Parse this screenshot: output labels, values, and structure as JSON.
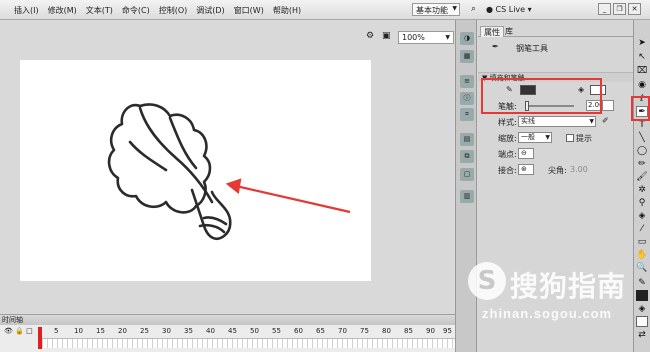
{
  "menubar": {
    "items": [
      "插入(I)",
      "修改(M)",
      "文本(T)",
      "命令(C)",
      "控制(O)",
      "调试(D)",
      "窗口(W)",
      "帮助(H)"
    ],
    "workspace": "基本功能",
    "cs_live": "CS Live"
  },
  "stage": {
    "zoom": "100%"
  },
  "timeline": {
    "title": "时间轴",
    "ruler": [
      "1",
      "5",
      "10",
      "15",
      "20",
      "25",
      "30",
      "35",
      "40",
      "45",
      "50",
      "55",
      "60",
      "65",
      "70",
      "75",
      "80",
      "85",
      "90",
      "95"
    ]
  },
  "properties": {
    "tabs": [
      "属性",
      "库"
    ],
    "tool_name": "钢笔工具",
    "section": "填充和笔触",
    "stroke_label": "笔触:",
    "stroke_value": "2.00",
    "style_label": "样式:",
    "style_value": "实线",
    "scale_label": "缩放:",
    "scale_value": "一般",
    "hint_label": "提示",
    "cap_label": "端点:",
    "join_label": "接合:",
    "miter_label": "尖角:",
    "miter_value": "3.00"
  },
  "colors": {
    "stroke": "#333333",
    "fill": "#ffffff",
    "highlight": "#e53935"
  },
  "watermark": {
    "text": "搜狗指南",
    "url": "zhinan.sogou.com"
  }
}
